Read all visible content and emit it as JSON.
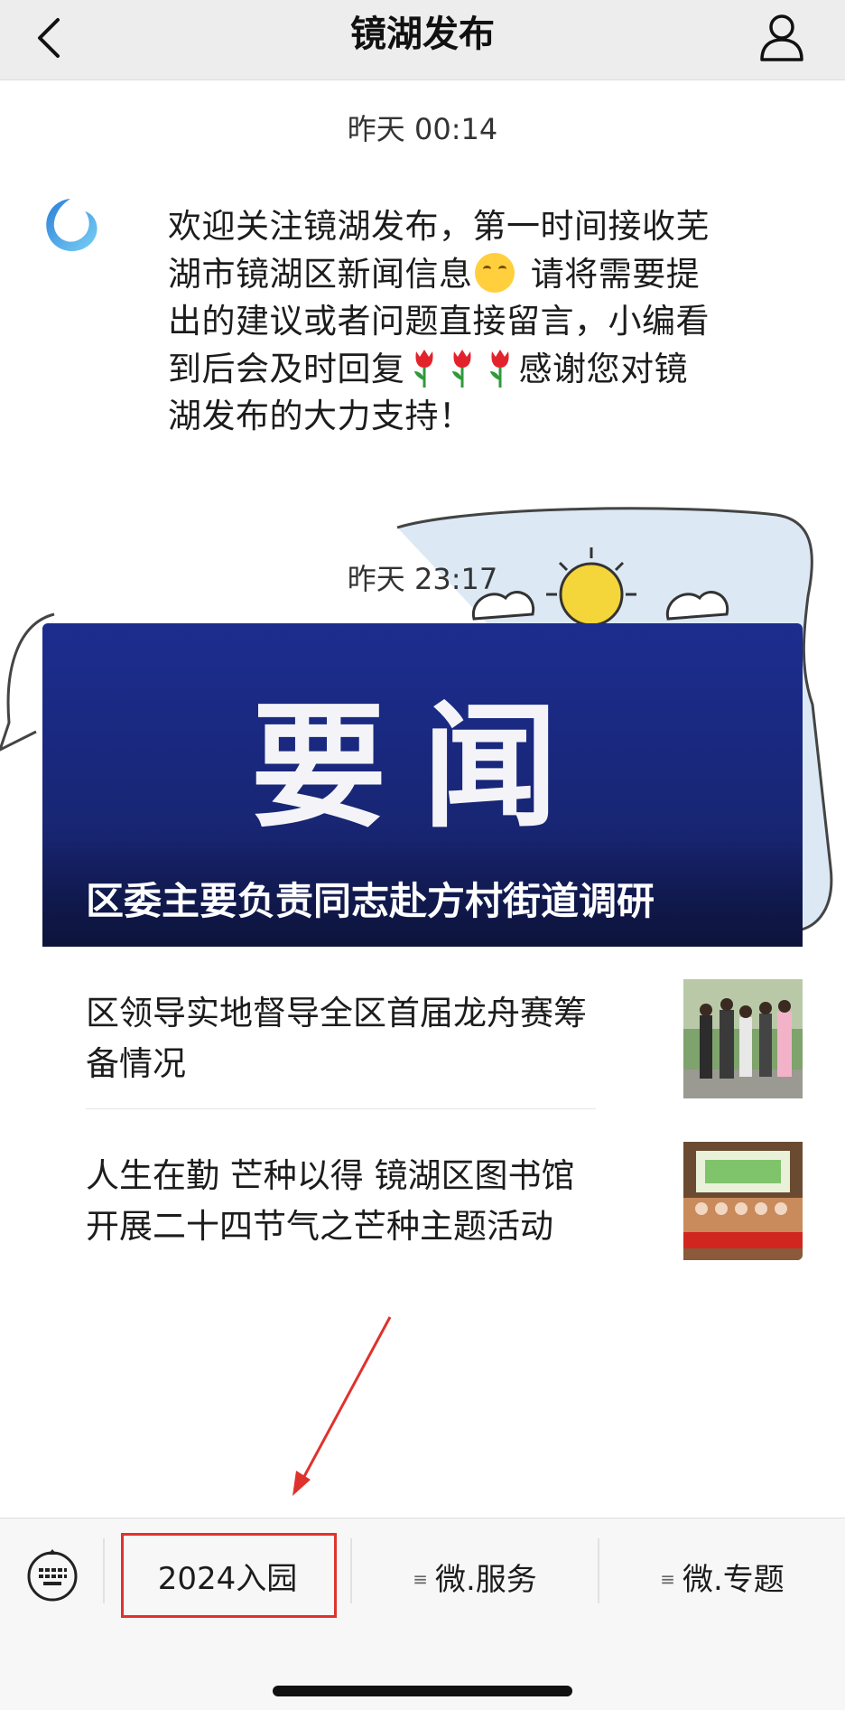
{
  "nav": {
    "title": "镜湖发布"
  },
  "messages": [
    {
      "time": "昨天 00:14",
      "text_parts": [
        "欢迎关注镜湖发布，第一时间接收芜湖市镜湖区新闻信息",
        " 请将需要提出的建议或者问题直接留言，小编看到后会及时回复",
        "感谢您对镜湖发布的大力支持！"
      ],
      "emoji": [
        "smiling-face",
        "tulip",
        "tulip",
        "tulip"
      ]
    },
    {
      "time": "昨天 23:17"
    }
  ],
  "article_card": {
    "banner_text": "要闻",
    "headline": "区委主要负责同志赴方村街道调研",
    "items": [
      {
        "title": "区领导实地督导全区首届龙舟赛筹备情况"
      },
      {
        "title": "人生在勤 芒种以得 镜湖区图书馆开展二十四节气之芒种主题活动"
      }
    ]
  },
  "toolbar": {
    "menus": [
      {
        "label": "2024入园",
        "highlighted": true
      },
      {
        "label": "微.服务"
      },
      {
        "label": "微.专题"
      }
    ]
  },
  "colors": {
    "highlight": "#e0322c",
    "banner_blue": "#1c2d8f",
    "nav_bg": "#ededed"
  }
}
